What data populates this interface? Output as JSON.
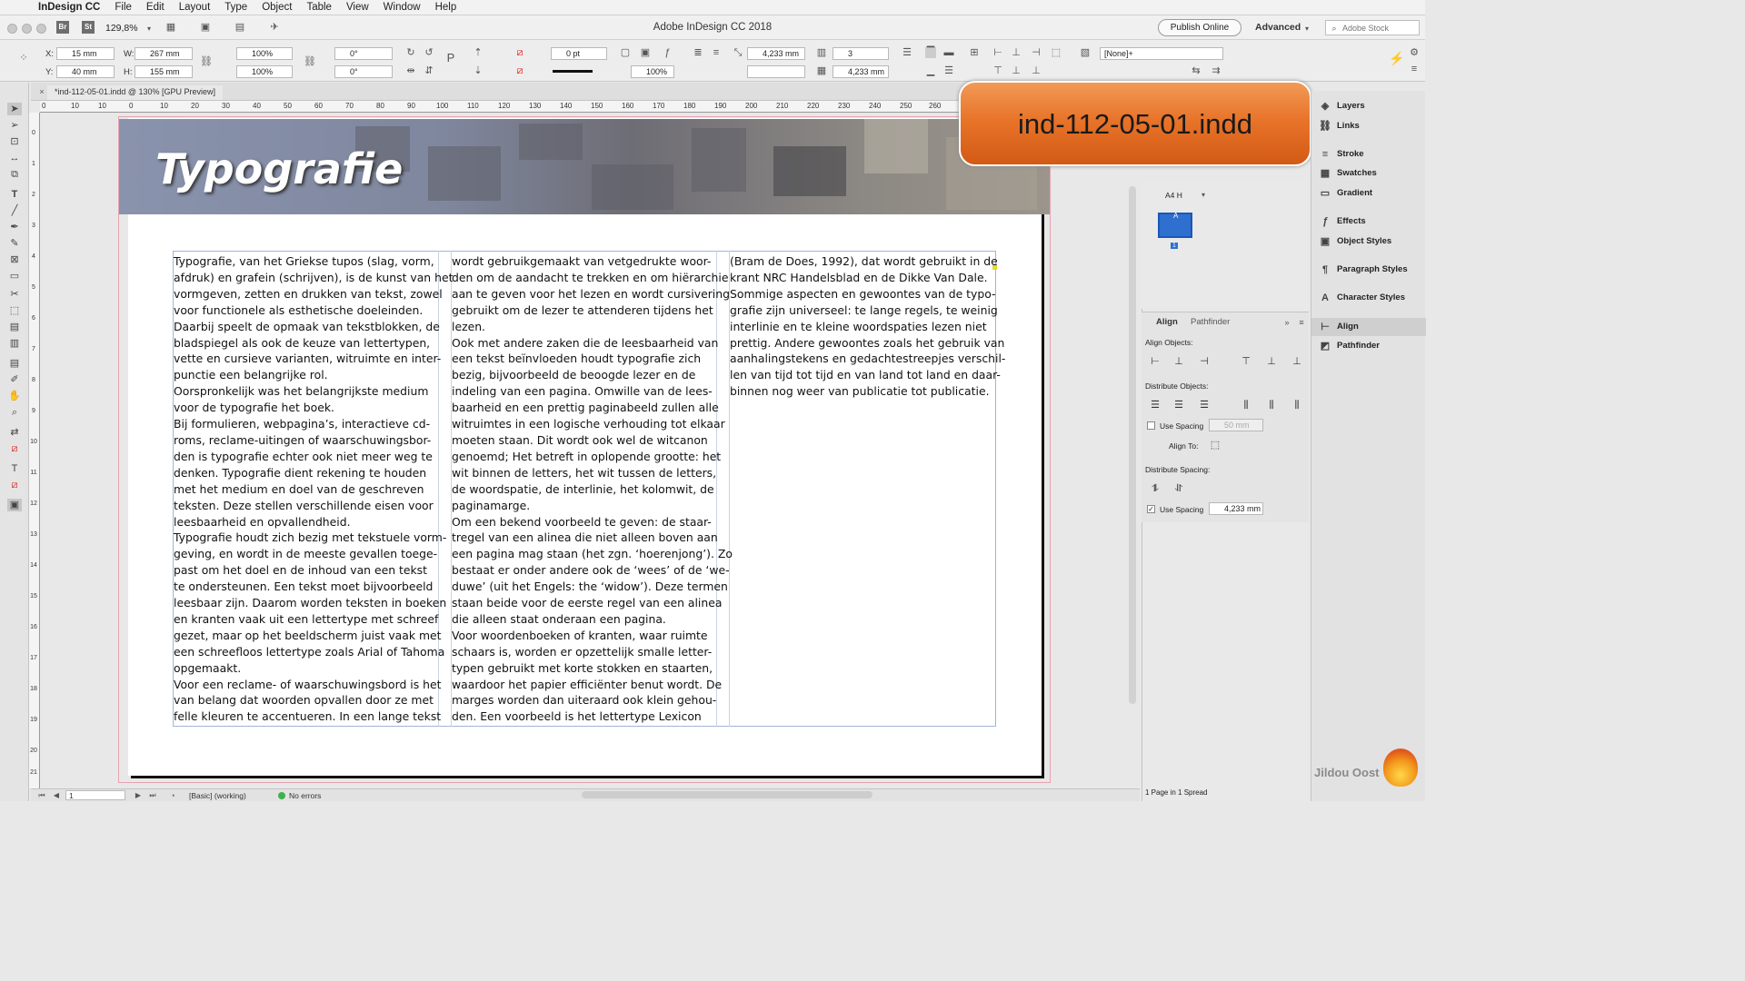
{
  "menubar": {
    "app": "InDesign CC",
    "items": [
      "File",
      "Edit",
      "Layout",
      "Type",
      "Object",
      "Table",
      "View",
      "Window",
      "Help"
    ]
  },
  "appbar": {
    "zoom": "129,8%",
    "br_badge": "Br",
    "st_badge": "St",
    "title": "Adobe InDesign CC 2018",
    "publish": "Publish Online",
    "workspace": "Advanced",
    "stock_placeholder": "Adobe Stock"
  },
  "control": {
    "x_label": "X:",
    "x_value": "15 mm",
    "y_label": "Y:",
    "y_value": "40 mm",
    "w_label": "W:",
    "w_value": "267 mm",
    "h_label": "H:",
    "h_value": "155 mm",
    "scale_x": "100%",
    "scale_y": "100%",
    "rotate": "0°",
    "shear": "0°",
    "stroke_weight": "0 pt",
    "opacity": "100%",
    "spacing": "4,233 mm",
    "columns": "3",
    "gutter": "4,233 mm",
    "style": "[None]+"
  },
  "document_tab": "*ind-112-05-01.indd @ 130% [GPU Preview]",
  "ruler": {
    "h": [
      "0",
      "10",
      "10",
      "0",
      "10",
      "20",
      "30",
      "40",
      "50",
      "60",
      "70",
      "80",
      "90",
      "100",
      "110",
      "120",
      "130",
      "140",
      "150",
      "160",
      "170",
      "180",
      "190",
      "200",
      "210",
      "220",
      "230",
      "240",
      "250",
      "260"
    ],
    "v": [
      "0",
      "1",
      "2",
      "3",
      "4",
      "5",
      "6",
      "7",
      "8",
      "9",
      "10",
      "11",
      "12",
      "13",
      "14",
      "15",
      "16",
      "17",
      "18",
      "19",
      "20",
      "21",
      "22"
    ]
  },
  "page": {
    "banner_title": "Typografie",
    "columns": [
      "Typografie, van het Griekse tupos (slag, vorm,\nafdruk) en grafein (schrijven), is de kunst van het\nvormgeven, zetten en drukken van tekst, zowel\nvoor functionele als esthetische doeleinden.\nDaarbij speelt de opmaak van tekstblokken, de\nbladspiegel als ook de keuze van lettertypen,\nvette en cursieve varianten, witruimte en inter-\npunctie een belangrijke rol.\nOorspronkelijk was het belangrijkste medium\nvoor de typografie het boek.\nBij formulieren, webpagina’s, interactieve cd-\nroms, reclame-uitingen of waarschuwingsbor-\nden is typografie echter ook niet meer weg te\ndenken. Typografie dient rekening te houden\nmet het medium en doel van de geschreven\nteksten. Deze stellen verschillende eisen voor\nleesbaarheid en opvallendheid.\nTypografie houdt zich bezig met tekstuele vorm-\ngeving, en wordt in de meeste gevallen toege-\npast om het doel en de inhoud van een tekst\nte ondersteunen. Een tekst moet bijvoorbeeld\nleesbaar zijn. Daarom worden teksten in boeken\nen kranten vaak uit een lettertype met schreef\ngezet, maar op het beeldscherm juist vaak met\neen schreefloos lettertype zoals Arial of Tahoma\nopgemaakt.\nVoor een reclame- of waarschuwingsbord is het\nvan belang dat woorden opvallen door ze met\nfelle kleuren te accentueren. In een lange tekst",
      "wordt gebruikgemaakt van vetgedrukte woor-\nden om de aandacht te trekken en om hiërarchie\naan te geven voor het lezen en wordt cursivering\ngebruikt om de lezer te attenderen tijdens het\nlezen.\nOok met andere zaken die de leesbaarheid van\neen tekst beïnvloeden houdt typografie zich\nbezig, bijvoorbeeld de beoogde lezer en de\nindeling van een pagina. Omwille van de lees-\nbaarheid en een prettig paginabeeld zullen alle\nwitruimtes in een logische verhouding tot elkaar\nmoeten staan. Dit wordt ook wel de witcanon\ngenoemd; Het betreft in oplopende grootte: het\nwit binnen de letters, het wit tussen de letters,\nde woordspatie, de interlinie, het kolomwit, de\npaginamarge.\nOm een bekend voorbeeld te geven: de staar-\ntregel van een alinea die niet alleen boven aan\neen pagina mag staan (het zgn. ‘hoerenjong’). Zo\nbestaat er onder andere ook de ‘wees’ of de ‘we-\nduwe’ (uit het Engels: the ‘widow’). Deze termen\nstaan beide voor de eerste regel van een alinea\ndie alleen staat onderaan een pagina.\nVoor woordenboeken of kranten, waar ruimte\nschaars is, worden er opzettelijk smalle letter-\ntypen gebruikt met korte stokken en staarten,\nwaardoor het papier efficiënter benut wordt. De\nmarges worden dan uiteraard ook klein gehou-\nden. Een voorbeeld is het lettertype Lexicon",
      "(Bram de Does, 1992), dat wordt gebruikt in de\nkrant NRC Handelsblad en de Dikke Van Dale.\nSommige aspecten en gewoontes van de typo-\ngrafie zijn universeel: te lange regels, te weinig\ninterlinie en te kleine woordspaties lezen niet\nprettig. Andere gewoontes zoals het gebruik van\naanhalingstekens en gedachtestreepjes verschil-\nlen van tijd tot tijd en van land tot land en daar-\nbinnen nog weer van publicatie tot publicatie."
    ]
  },
  "file_badge": "ind-112-05-01.indd",
  "pages_panel": {
    "master": "A4 H",
    "page_number": "1",
    "master_letter": "A"
  },
  "align_panel": {
    "tab_align": "Align",
    "tab_pathfinder": "Pathfinder",
    "align_objects": "Align Objects:",
    "distribute_objects": "Distribute Objects:",
    "use_spacing_1": "Use Spacing",
    "use_spacing_1_value": "50 mm",
    "align_to": "Align To:",
    "distribute_spacing": "Distribute Spacing:",
    "use_spacing_2": "Use Spacing",
    "use_spacing_2_value": "4,233 mm"
  },
  "dock": {
    "items": [
      "Layers",
      "Links",
      "Stroke",
      "Swatches",
      "Gradient",
      "Effects",
      "Object Styles",
      "Paragraph Styles",
      "Character Styles",
      "Align",
      "Pathfinder"
    ],
    "status": "1 Page in 1 Spread"
  },
  "status": {
    "page": "1",
    "style": "[Basic] (working)",
    "errors": "No errors"
  },
  "watermark": "Jildou Oost"
}
